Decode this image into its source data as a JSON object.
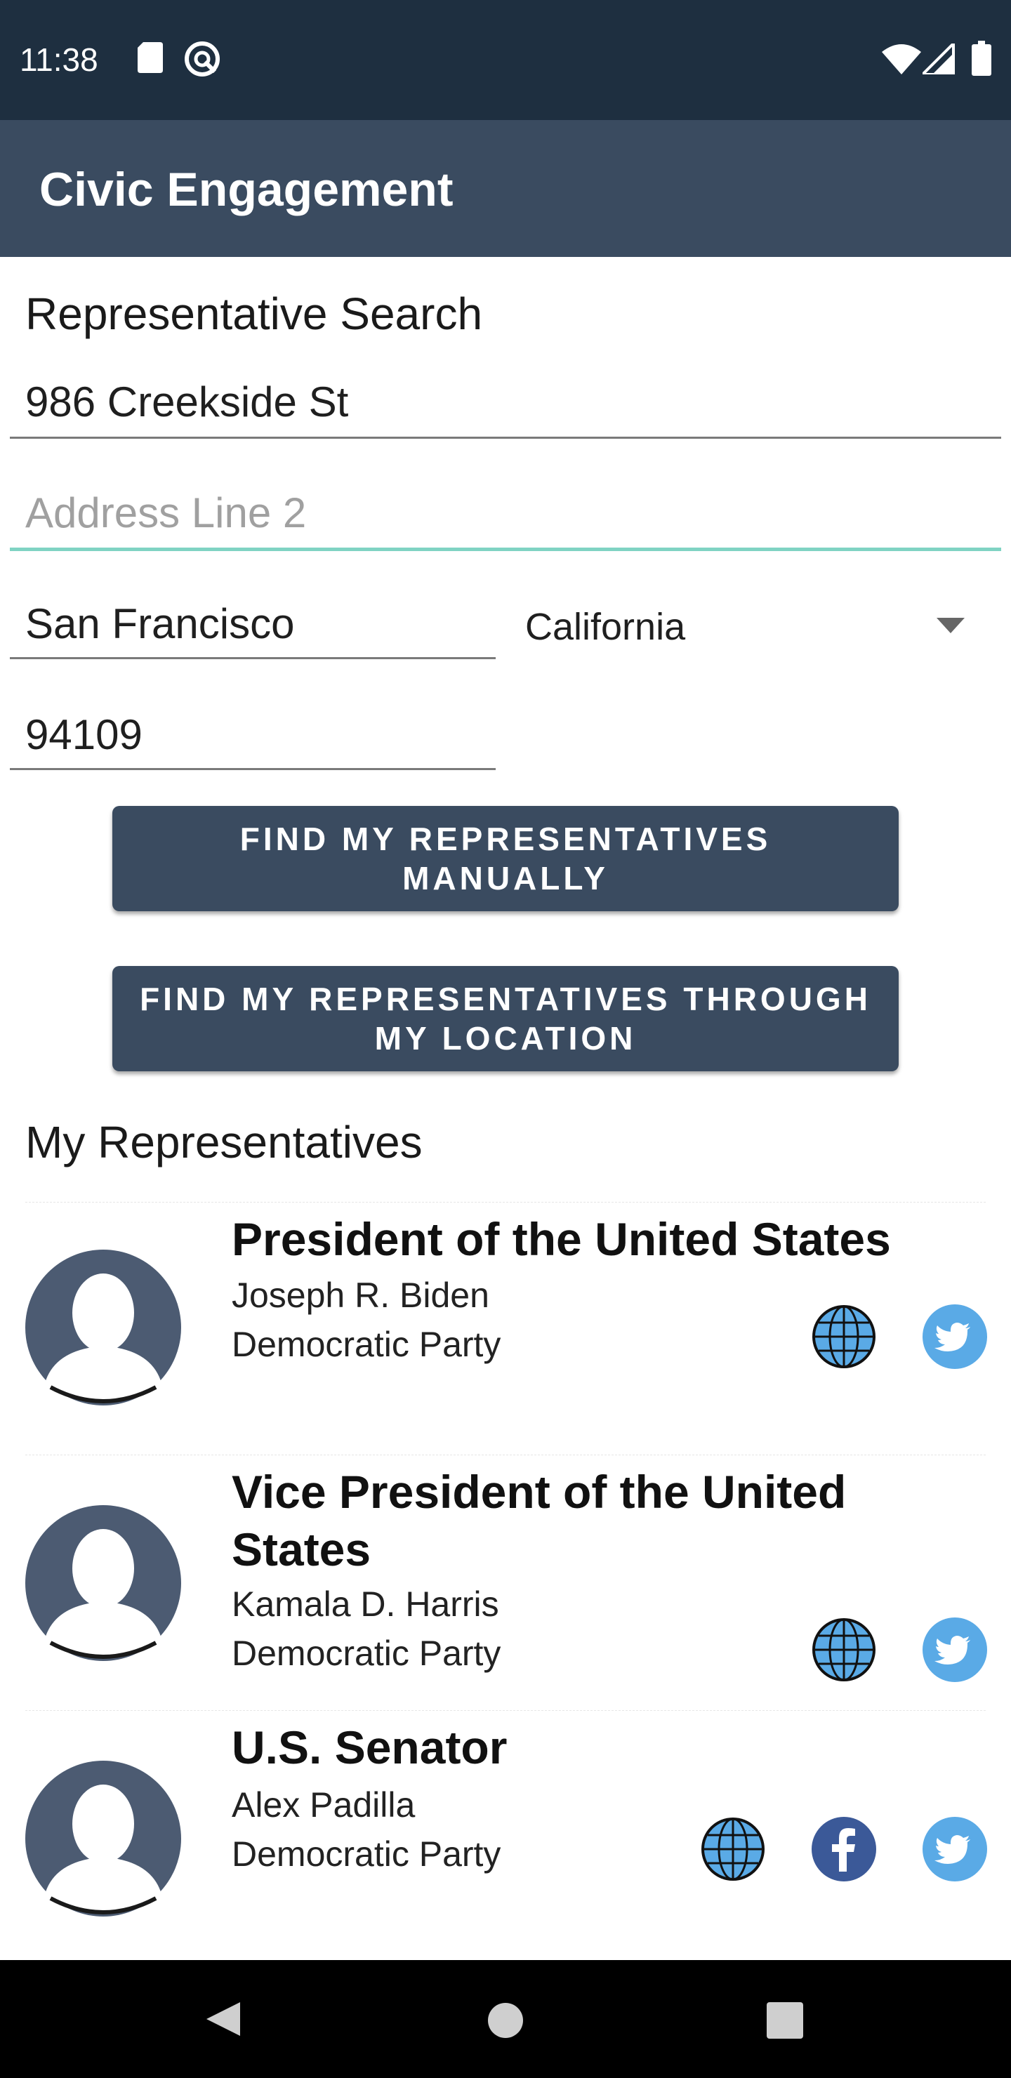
{
  "status_bar": {
    "time": "11:38",
    "icons": [
      "sd-card-icon",
      "do-not-disturb-icon",
      "wifi-icon",
      "signal-icon",
      "battery-icon"
    ]
  },
  "app_bar": {
    "title": "Civic Engagement"
  },
  "search": {
    "section_title": "Representative Search",
    "address1": "986 Creekside St",
    "address2_placeholder": "Address Line 2",
    "city": "San Francisco",
    "state": "California",
    "zip": "94109"
  },
  "buttons": {
    "manual_line1": "FIND MY REPRESENTATIVES",
    "manual_line2": "MANUALLY",
    "location_line1": "FIND MY REPRESENTATIVES THROUGH",
    "location_line2": "MY LOCATION"
  },
  "representatives": {
    "section_title": "My Representatives",
    "items": [
      {
        "title": "President of the United States",
        "name": "Joseph R. Biden",
        "party": "Democratic Party",
        "links": [
          "globe-icon",
          "twitter-icon"
        ]
      },
      {
        "title_line1": "Vice President of the United",
        "title_line2": "States",
        "name": "Kamala D. Harris",
        "party": "Democratic Party",
        "links": [
          "globe-icon",
          "twitter-icon"
        ]
      },
      {
        "title": "U.S. Senator",
        "name": "Alex Padilla",
        "party": "Democratic Party",
        "links": [
          "globe-icon",
          "facebook-icon",
          "twitter-icon"
        ]
      }
    ]
  },
  "colors": {
    "status_bar": "#1e2f40",
    "app_bar": "#3a4b60",
    "button": "#3a4b60",
    "focus_underline": "#7fd3c3",
    "twitter": "#5aaae6",
    "facebook": "#3b5998"
  }
}
